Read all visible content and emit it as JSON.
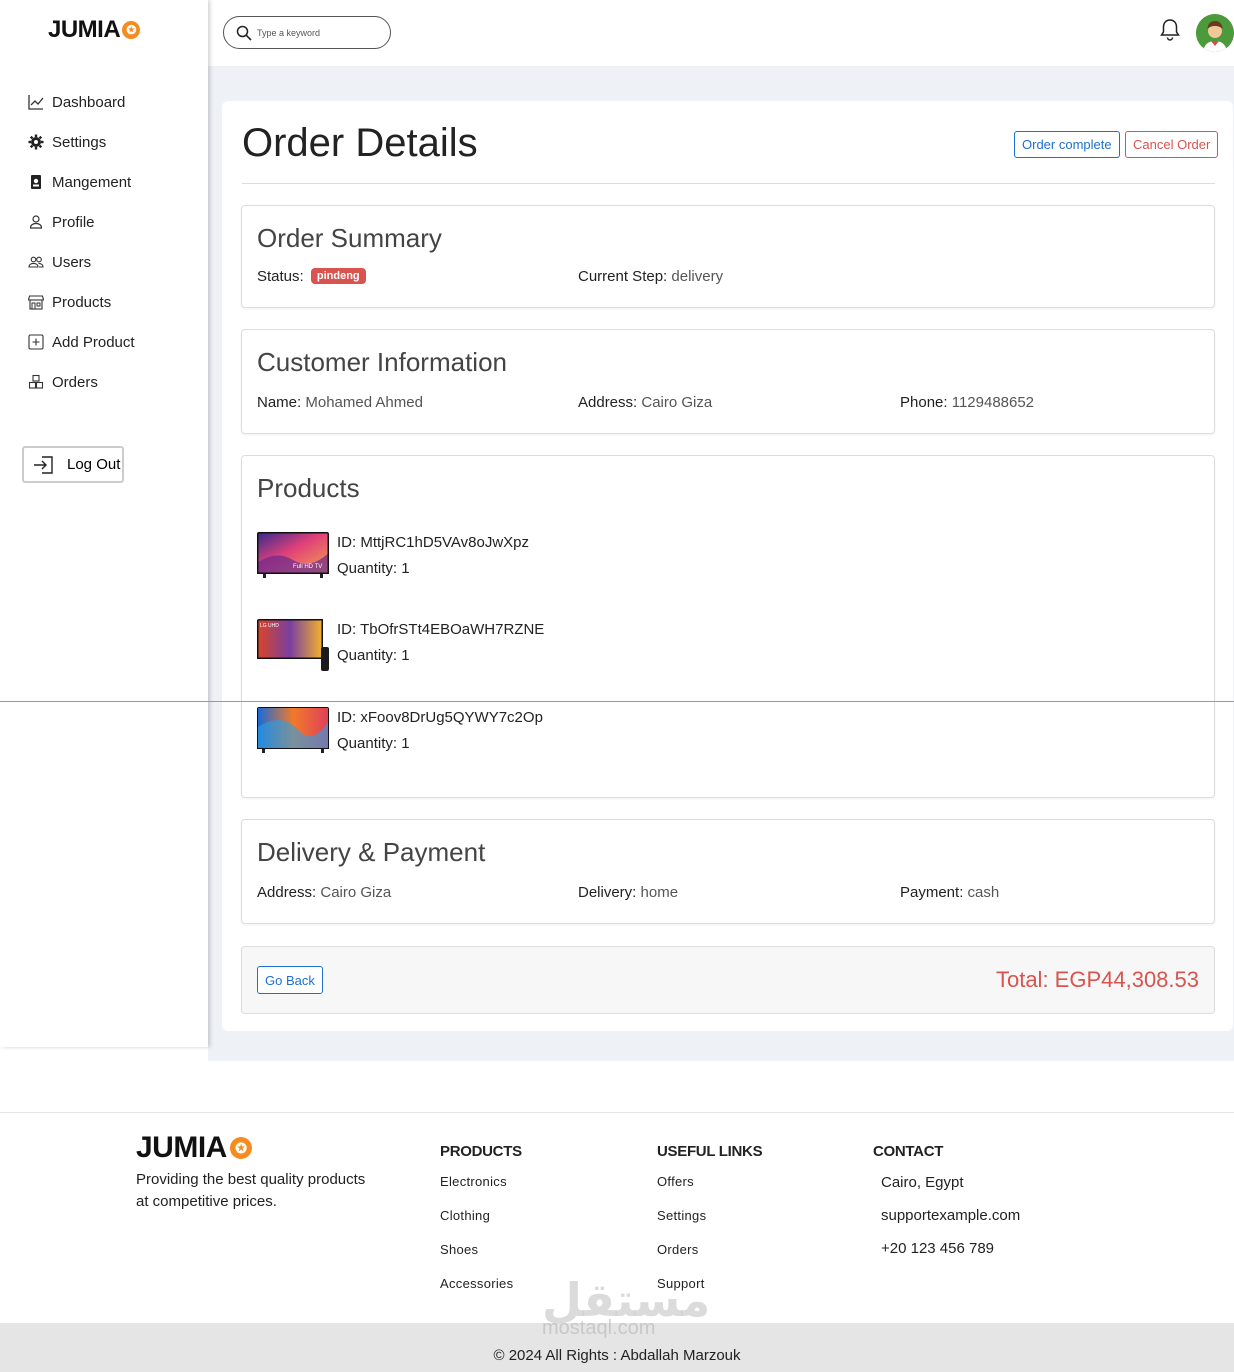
{
  "brand": {
    "name": "JUMIA",
    "star": "✪"
  },
  "search": {
    "placeholder": "Type a keyword"
  },
  "sidebar": {
    "items": [
      {
        "label": "Dashboard",
        "icon": "chart-line-icon"
      },
      {
        "label": "Settings",
        "icon": "gear-icon"
      },
      {
        "label": "Mangement",
        "icon": "badge-icon"
      },
      {
        "label": "Profile",
        "icon": "person-icon"
      },
      {
        "label": "Users",
        "icon": "people-icon"
      },
      {
        "label": "Products",
        "icon": "shop-icon"
      },
      {
        "label": "Add Product",
        "icon": "plus-square-icon"
      },
      {
        "label": "Orders",
        "icon": "boxes-icon"
      }
    ],
    "logout_label": "Log Out"
  },
  "page": {
    "title": "Order Details",
    "order_complete_label": "Order complete",
    "cancel_order_label": "Cancel Order"
  },
  "order_summary": {
    "heading": "Order Summary",
    "status_label": "Status:",
    "status_value": "pindeng",
    "step_label": "Current Step:",
    "step_value": "delivery"
  },
  "customer": {
    "heading": "Customer Information",
    "name_label": "Name:",
    "name_value": "Mohamed Ahmed",
    "address_label": "Address:",
    "address_value": "Cairo Giza",
    "phone_label": "Phone:",
    "phone_value": "1129488652"
  },
  "products": {
    "heading": "Products",
    "id_label": "ID:",
    "qty_label": "Quantity:",
    "items": [
      {
        "id": "MttjRC1hD5VAv8oJwXpz",
        "quantity": "1",
        "thumb_caption": "Full HD TV"
      },
      {
        "id": "TbOfrSTt4EBOaWH7RZNE",
        "quantity": "1",
        "thumb_caption": "LG UHD"
      },
      {
        "id": "xFoov8DrUg5QYWY7c2Op",
        "quantity": "1",
        "thumb_caption": ""
      }
    ]
  },
  "delivery": {
    "heading": "Delivery & Payment",
    "address_label": "Address:",
    "address_value": "Cairo Giza",
    "delivery_label": "Delivery:",
    "delivery_value": "home",
    "payment_label": "Payment:",
    "payment_value": "cash"
  },
  "summary_bar": {
    "go_back_label": "Go Back",
    "total": "Total: EGP44,308.53"
  },
  "footer": {
    "tagline": "Providing the best quality products at competitive prices.",
    "products_heading": "PRODUCTS",
    "products_links": [
      "Electronics",
      "Clothing",
      "Shoes",
      "Accessories"
    ],
    "useful_heading": "USEFUL LINKS",
    "useful_links": [
      "Offers",
      "Settings",
      "Orders",
      "Support"
    ],
    "contact_heading": "CONTACT",
    "contact_lines": [
      "Cairo, Egypt",
      "supportexample.com",
      "+20 123 456 789"
    ],
    "copyright": "© 2024 All Rights : Abdallah Marzouk",
    "watermark": "مستقل",
    "watermark_sub": "mostaql.com"
  },
  "colors": {
    "accent_blue": "#1f6fd1",
    "danger_red": "#d9534f",
    "brand_orange": "#f68b1e",
    "page_bg": "#eef1f6"
  }
}
